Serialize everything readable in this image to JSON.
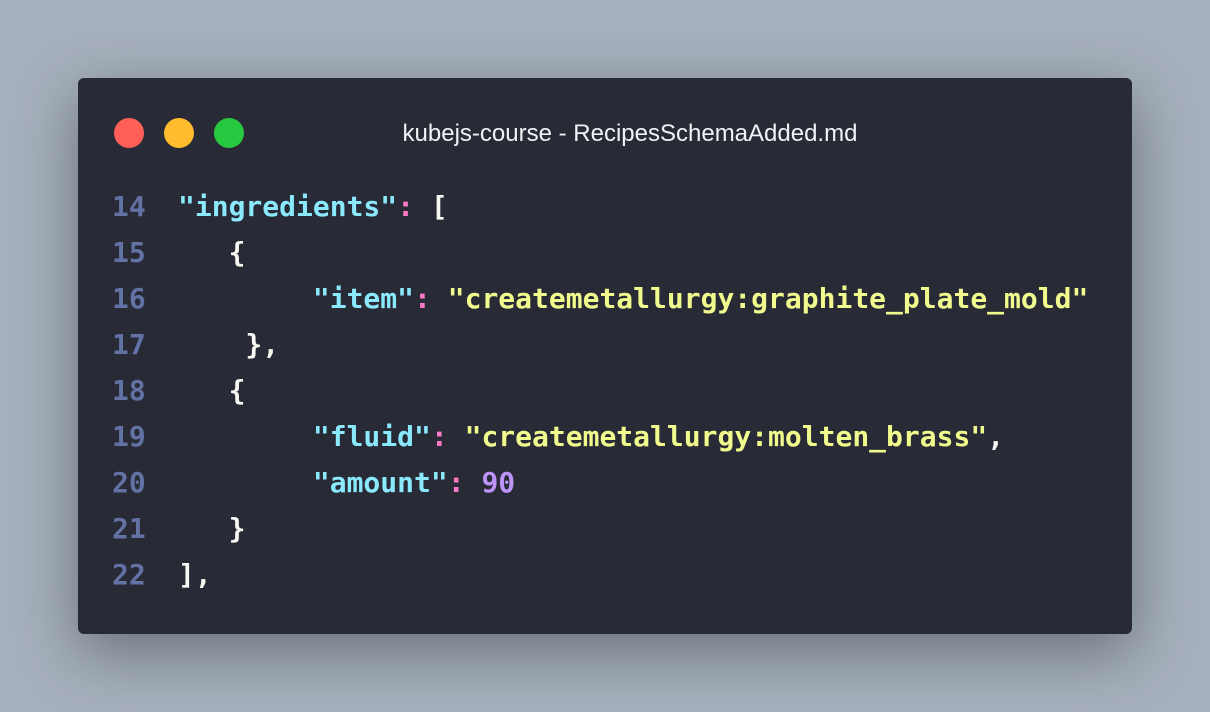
{
  "window": {
    "title": "kubejs-course - RecipesSchemaAdded.md",
    "controls": [
      "close-dot",
      "minimize-dot",
      "maximize-dot"
    ],
    "colors": {
      "background": "#282a36",
      "close": "#ff5f57",
      "minimize": "#febc2e",
      "maximize": "#28c840"
    }
  },
  "code": {
    "line_numbers": [
      "14",
      "15",
      "16",
      "17",
      "18",
      "19",
      "20",
      "21",
      "22"
    ],
    "lines": [
      [
        {
          "t": "key",
          "v": "\"ingredients\""
        },
        {
          "t": "punct",
          "v": ":"
        },
        {
          "t": "plain",
          "v": " ["
        }
      ],
      [
        {
          "t": "plain",
          "v": "   {"
        }
      ],
      [
        {
          "t": "plain",
          "v": "        "
        },
        {
          "t": "key",
          "v": "\"item\""
        },
        {
          "t": "punct",
          "v": ":"
        },
        {
          "t": "plain",
          "v": " "
        },
        {
          "t": "str",
          "v": "\"createmetallurgy:graphite_plate_mold\""
        }
      ],
      [
        {
          "t": "plain",
          "v": "    },"
        }
      ],
      [
        {
          "t": "plain",
          "v": "   {"
        }
      ],
      [
        {
          "t": "plain",
          "v": "        "
        },
        {
          "t": "key",
          "v": "\"fluid\""
        },
        {
          "t": "punct",
          "v": ":"
        },
        {
          "t": "plain",
          "v": " "
        },
        {
          "t": "str",
          "v": "\"createmetallurgy:molten_brass\""
        },
        {
          "t": "plain",
          "v": ","
        }
      ],
      [
        {
          "t": "plain",
          "v": "        "
        },
        {
          "t": "key",
          "v": "\"amount\""
        },
        {
          "t": "punct",
          "v": ":"
        },
        {
          "t": "plain",
          "v": " "
        },
        {
          "t": "num",
          "v": "90"
        }
      ],
      [
        {
          "t": "plain",
          "v": "   }"
        }
      ],
      [
        {
          "t": "plain",
          "v": "],"
        }
      ]
    ]
  },
  "syntax_colors": {
    "key": "#8be9fd",
    "punct": "#ff79c6",
    "str": "#f1fa8c",
    "num": "#bd93f9",
    "plain": "#f8f8f2",
    "line_number": "#6272a4"
  }
}
